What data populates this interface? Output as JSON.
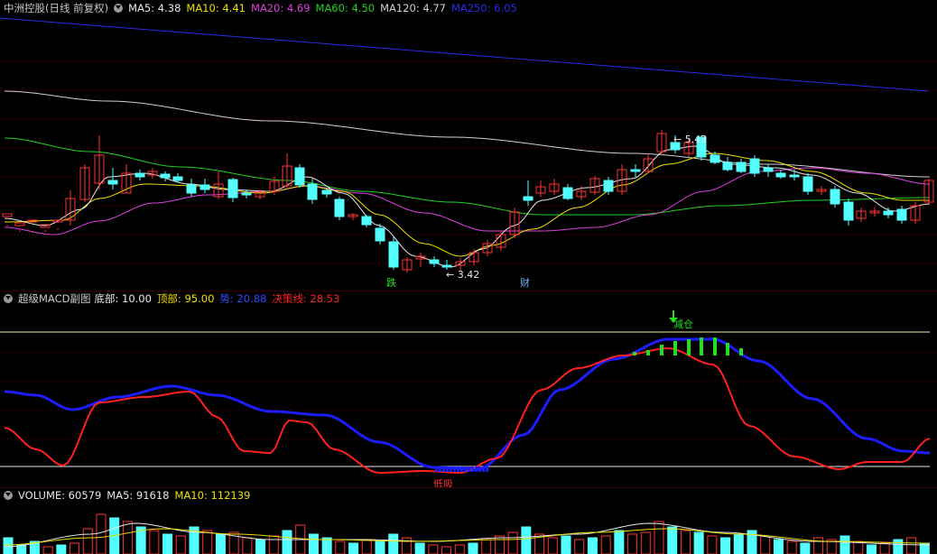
{
  "main": {
    "stock_title": "中洲控股(日线 前复权)",
    "ma": [
      {
        "label": "MA5: 4.38",
        "color": "#e8e8e8"
      },
      {
        "label": "MA10: 4.41",
        "color": "#f0e000"
      },
      {
        "label": "MA20: 4.69",
        "color": "#e040e0"
      },
      {
        "label": "MA60: 4.50",
        "color": "#20d020"
      },
      {
        "label": "MA120: 4.77",
        "color": "#d0d0d0"
      },
      {
        "label": "MA250: 6.05",
        "color": "#2a2ae8"
      }
    ],
    "high_label": "5.43",
    "low_label": "3.42",
    "marker_fall": "跌",
    "marker_fin": "财"
  },
  "macd": {
    "title": "超级MACD副图",
    "bottom": "底部: 10.00",
    "top": "顶部: 95.00",
    "trend": "势: 20.88",
    "decision": "决策线: 28.53",
    "reduce_label": "减仓",
    "bottom_buy_label": "低吸"
  },
  "volume": {
    "title": "VOLUME: 60579",
    "ma5": "MA5: 91618",
    "ma10": "MA10: 112139"
  },
  "colors": {
    "up": "#ff3232",
    "down": "#54ffff",
    "ma5": "#e8e8e8",
    "ma10": "#f0e000",
    "ma20": "#e040e0",
    "ma60": "#20d020",
    "ma120": "#d0d0d0",
    "ma250": "#2a2ae8",
    "trend_line": "#1c1cff",
    "decision_line": "#ff2020"
  },
  "chart_data": [
    {
      "type": "candlestick",
      "title": "中洲控股(日线 前复权)",
      "annotations": [
        "5.43",
        "3.42",
        "跌",
        "财"
      ],
      "series": [
        {
          "name": "MA5",
          "last": 4.38
        },
        {
          "name": "MA10",
          "last": 4.41
        },
        {
          "name": "MA20",
          "last": 4.69
        },
        {
          "name": "MA60",
          "last": 4.5
        },
        {
          "name": "MA120",
          "last": 4.77
        },
        {
          "name": "MA250",
          "last": 6.05
        }
      ],
      "high": 5.43,
      "low": 3.42
    },
    {
      "type": "line",
      "title": "超级MACD副图",
      "series": [
        {
          "name": "势",
          "last": 20.88
        },
        {
          "name": "决策线",
          "last": 28.53
        }
      ],
      "levels": {
        "底部": 10.0,
        "顶部": 95.0
      },
      "annotations": [
        "减仓",
        "低吸"
      ]
    },
    {
      "type": "bar",
      "title": "VOLUME",
      "series": [
        {
          "name": "VOLUME",
          "last": 60579
        },
        {
          "name": "MA5",
          "last": 91618
        },
        {
          "name": "MA10",
          "last": 112139
        }
      ]
    }
  ]
}
